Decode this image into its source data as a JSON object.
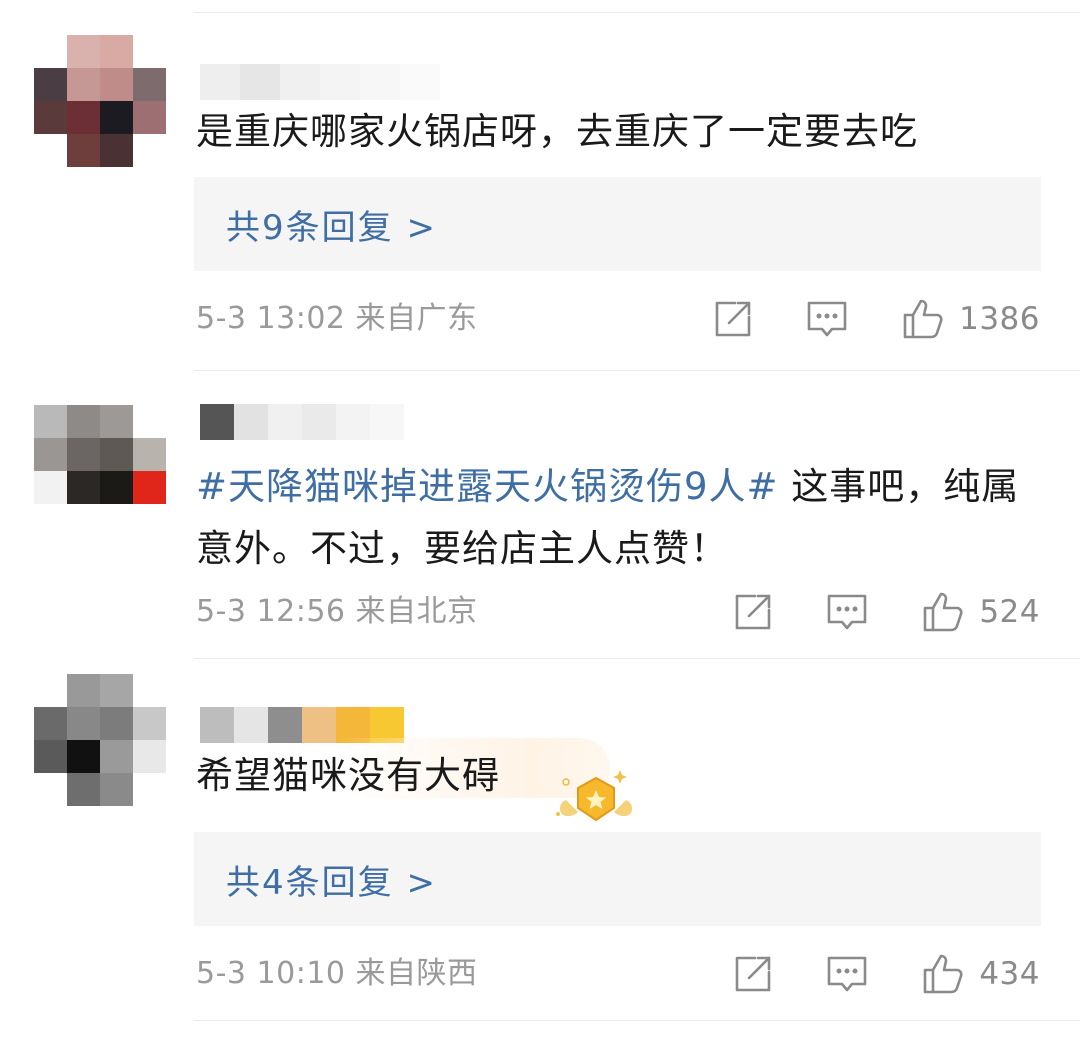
{
  "comments": [
    {
      "text": "是重庆哪家火锅店呀，去重庆了一定要去吃",
      "replies": "共9条回复 >",
      "time": "5-3 13:02",
      "location": "来自广东",
      "likes": "1386"
    },
    {
      "topic": "#天降猫咪掉进露天火锅烫伤9人#",
      "text": " 这事吧，纯属意外。不过，要给店主人点赞！",
      "time": "5-3 12:56",
      "location": "来自北京",
      "likes": "524"
    },
    {
      "text": "希望猫咪没有大碍",
      "replies": "共4条回复 >",
      "time": "5-3 10:10",
      "location": "来自陕西",
      "likes": "434"
    }
  ],
  "icons": {
    "share": "share-icon",
    "comment": "comment-icon",
    "like": "thumbs-up-icon",
    "badge": "star-badge-icon"
  },
  "colors": {
    "link": "#3e6ea3",
    "meta": "#9a9a9a",
    "reply_bg": "#f5f5f5"
  }
}
